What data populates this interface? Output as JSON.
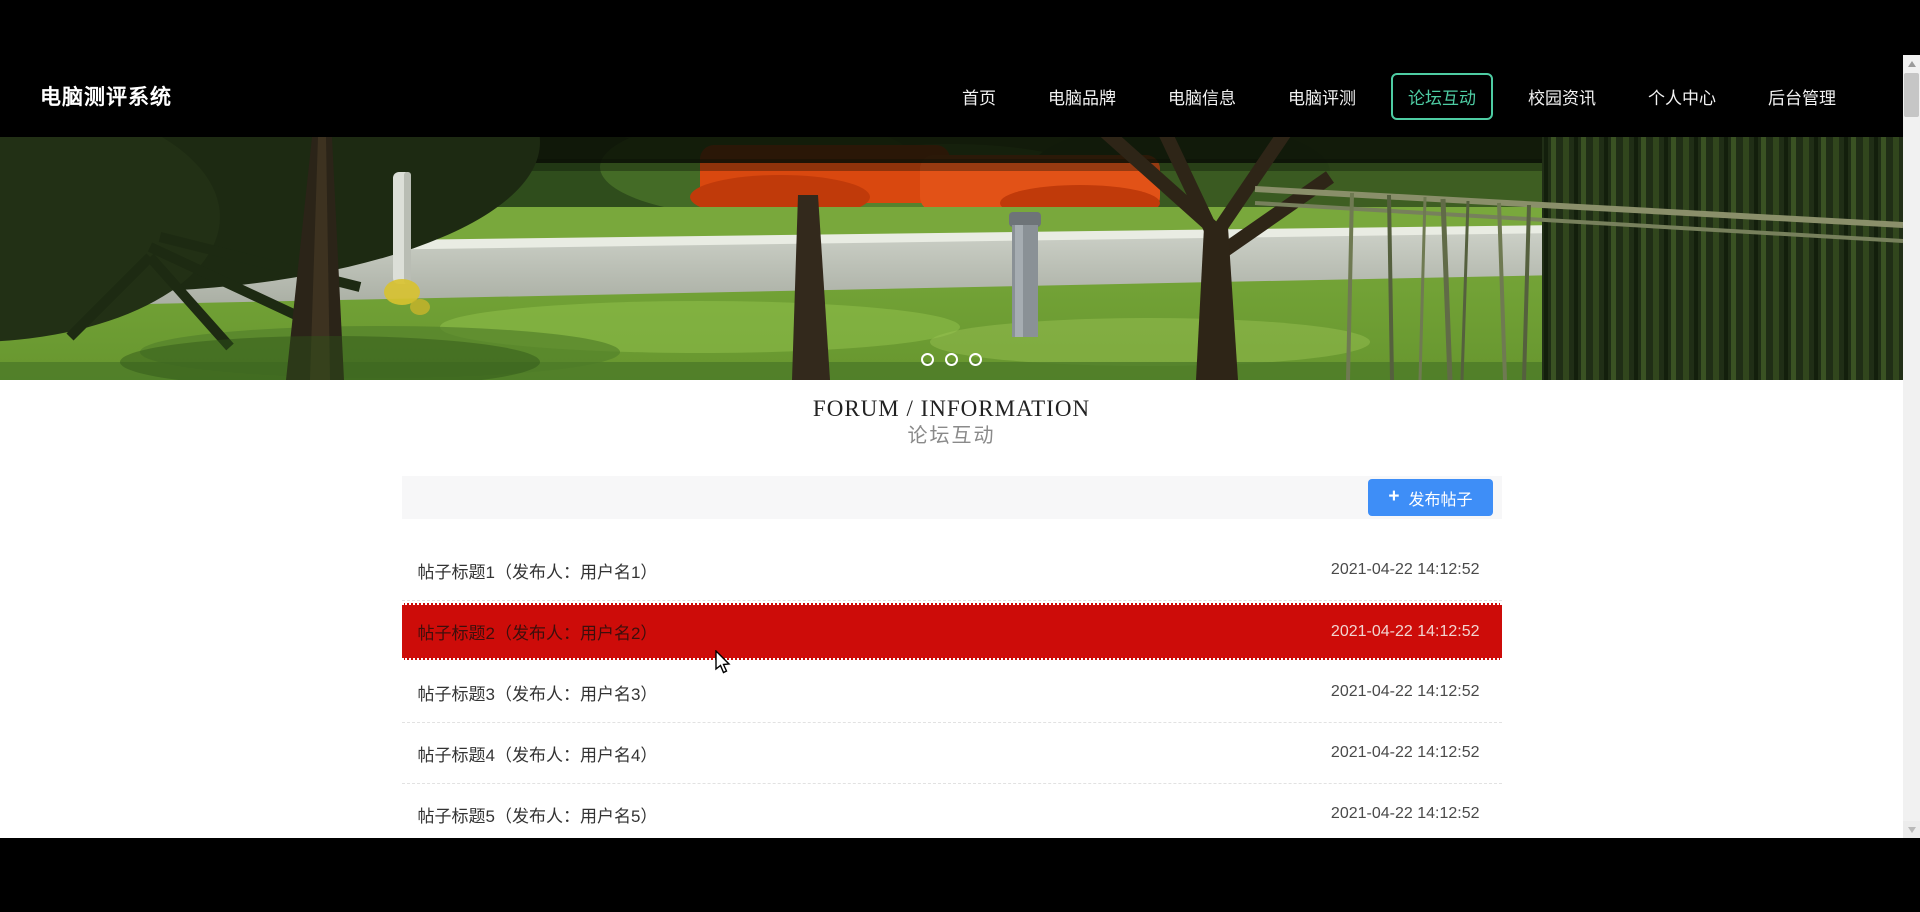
{
  "navbar": {
    "logo": "电脑测评系统",
    "items": [
      {
        "label": "首页",
        "active": false
      },
      {
        "label": "电脑品牌",
        "active": false
      },
      {
        "label": "电脑信息",
        "active": false
      },
      {
        "label": "电脑评测",
        "active": false
      },
      {
        "label": "论坛互动",
        "active": true
      },
      {
        "label": "校园资讯",
        "active": false
      },
      {
        "label": "个人中心",
        "active": false
      },
      {
        "label": "后台管理",
        "active": false
      }
    ]
  },
  "banner": {
    "slide_count": 3
  },
  "section": {
    "title_en": "FORUM / INFORMATION",
    "title_zh": "论坛互动"
  },
  "toolbar": {
    "plus_icon": "+",
    "publish_label": "发布帖子"
  },
  "posts": [
    {
      "title": "帖子标题1（发布人：用户名1）",
      "time": "2021-04-22 14:12:52",
      "highlighted": false
    },
    {
      "title": "帖子标题2（发布人：用户名2）",
      "time": "2021-04-22 14:12:52",
      "highlighted": true
    },
    {
      "title": "帖子标题3（发布人：用户名3）",
      "time": "2021-04-22 14:12:52",
      "highlighted": false
    },
    {
      "title": "帖子标题4（发布人：用户名4）",
      "time": "2021-04-22 14:12:52",
      "highlighted": false
    },
    {
      "title": "帖子标题5（发布人：用户名5）",
      "time": "2021-04-22 14:12:52",
      "highlighted": false
    }
  ],
  "colors": {
    "accent_teal": "#4ecca3",
    "primary_blue": "#3e8ef7",
    "highlight_red": "#cd0c09",
    "navbar_bg": "#000000",
    "toolbar_bg": "#f7f7f8"
  }
}
